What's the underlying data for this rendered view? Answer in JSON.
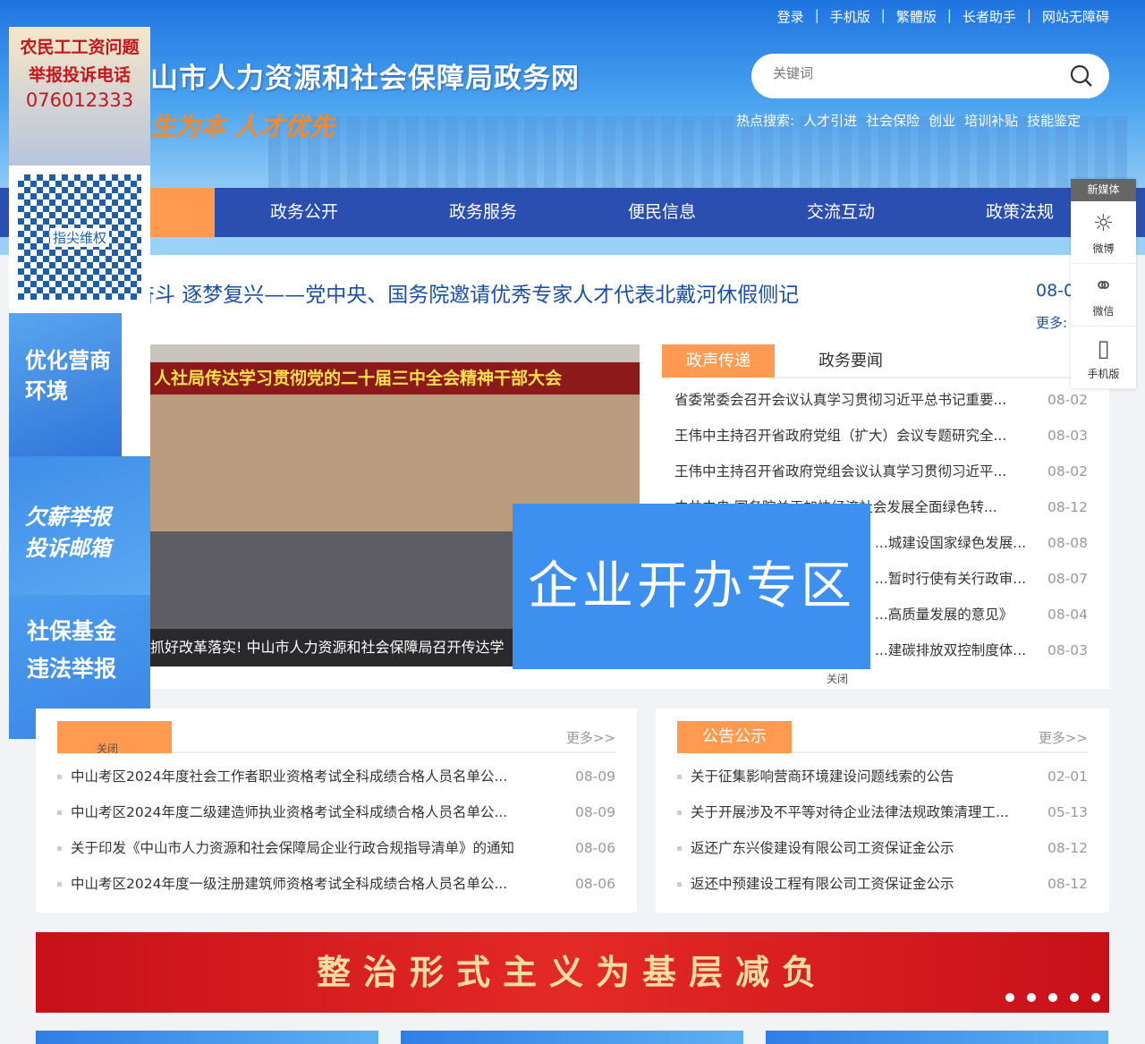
{
  "top_links": [
    "登录",
    "手机版",
    "繁體版",
    "长者助手",
    "网站无障碍"
  ],
  "site_title": "山市人力资源和社会保障局政务网",
  "slogan": "生为本  人才优先",
  "search": {
    "placeholder": "关键词"
  },
  "hot_search": {
    "label": "热点搜索:",
    "items": [
      "人才引进",
      "社会保险",
      "创业",
      "培训补贴",
      "技能鉴定"
    ]
  },
  "nav": [
    "政务公开",
    "政务服务",
    "便民信息",
    "交流互动",
    "政策法规"
  ],
  "headline": {
    "text": "爱国奋斗 逐梦复兴——党中央、国务院邀请优秀专家人才代表北戴河休假侧记",
    "date": "08-0",
    "more": "更多:"
  },
  "slider": {
    "banner": "人社局传达学习贯彻党的二十届三中全会精神干部大会",
    "caption": "抓好改革落实! 中山市人力资源和社会保障局召开传达学"
  },
  "tabs": [
    "政声传递",
    "政务要闻"
  ],
  "news": [
    {
      "title": "省委常委会召开会议认真学习贯彻习近平总书记重要...",
      "date": "08-02"
    },
    {
      "title": "王伟中主持召开省政府党组（扩大）会议专题研究全...",
      "date": "08-03"
    },
    {
      "title": "王伟中主持召开省政府党组会议认真学习贯彻习近平...",
      "date": "08-02"
    },
    {
      "title": "中共中央 国务院关于加快经济社会发展全面绿色转...",
      "date": "08-12"
    },
    {
      "title": "...城建设国家绿色发展...",
      "date": "08-08"
    },
    {
      "title": "...暂时行使有关行政审...",
      "date": "08-07"
    },
    {
      "title": "...高质量发展的意见》",
      "date": "08-04"
    },
    {
      "title": "...建碳排放双控制度体...",
      "date": "08-03"
    }
  ],
  "float_ad": {
    "text": "企业开办专区",
    "close": "关闭"
  },
  "left_ads": {
    "wage": [
      "农民工工资问题",
      "举报投诉电话",
      "076012333"
    ],
    "qr": "指尖维权",
    "business": "优化营商环境",
    "salary": [
      "欠薪举报",
      "投诉邮箱"
    ],
    "fund": [
      "社保基金",
      "违法举报"
    ],
    "close": "关闭"
  },
  "media": {
    "header": "新媒体",
    "items": [
      "微博",
      "微信",
      "手机版"
    ]
  },
  "panel_left": {
    "title": "",
    "more": "更多>>",
    "rows": [
      {
        "title": "中山考区2024年度社会工作者职业资格考试全科成绩合格人员名单公...",
        "date": "08-09"
      },
      {
        "title": "中山考区2024年度二级建造师执业资格考试全科成绩合格人员名单公...",
        "date": "08-09"
      },
      {
        "title": "关于印发《中山市人力资源和社会保障局企业行政合规指导清单》的通知",
        "date": "08-06"
      },
      {
        "title": "中山考区2024年度一级注册建筑师资格考试全科成绩合格人员名单公...",
        "date": "08-06"
      }
    ]
  },
  "panel_right": {
    "title": "公告公示",
    "more": "更多>>",
    "rows": [
      {
        "title": "关于征集影响营商环境建设问题线索的公告",
        "date": "02-01"
      },
      {
        "title": "关于开展涉及不平等对待企业法律法规政策清理工...",
        "date": "05-13"
      },
      {
        "title": "返还广东兴俊建设有限公司工资保证金公示",
        "date": "08-12"
      },
      {
        "title": "返还中预建设工程有限公司工资保证金公示",
        "date": "08-12"
      }
    ]
  },
  "banner": "整治形式主义为基层减负"
}
